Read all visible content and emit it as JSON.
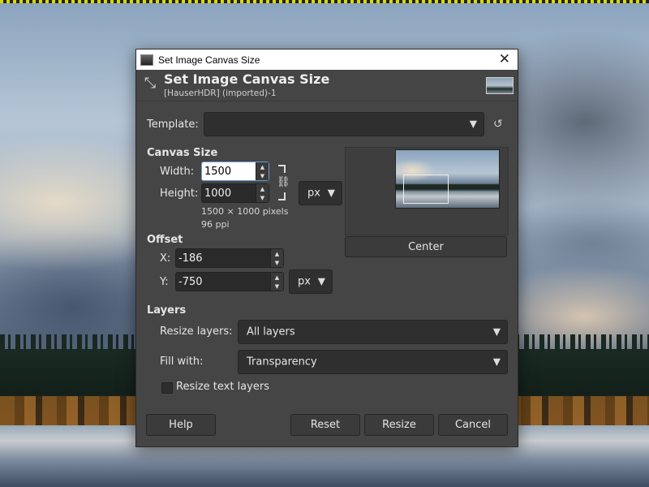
{
  "dialog": {
    "window_title": "Set Image Canvas Size",
    "header_title": "Set Image Canvas Size",
    "header_subtitle": "[HauserHDR] (imported)-1"
  },
  "template": {
    "label": "Template:",
    "value": ""
  },
  "canvas_size": {
    "section": "Canvas Size",
    "width_label": "Width:",
    "width_value": "1500",
    "height_label": "Height:",
    "height_value": "1000",
    "unit": "px",
    "pixels_info": "1500 × 1000 pixels",
    "ppi_info": "96 ppi"
  },
  "offset": {
    "section": "Offset",
    "x_label": "X:",
    "x_value": "-186",
    "y_label": "Y:",
    "y_value": "-750",
    "unit": "px",
    "center_label": "Center"
  },
  "layers": {
    "section": "Layers",
    "resize_label": "Resize layers:",
    "resize_value": "All layers",
    "fill_label": "Fill with:",
    "fill_value": "Transparency",
    "resize_text_label": "Resize text layers",
    "resize_text_checked": false
  },
  "buttons": {
    "help": "Help",
    "reset": "Reset",
    "resize": "Resize",
    "cancel": "Cancel"
  },
  "icons": {
    "close": "close-icon",
    "reset_template": "reset-icon",
    "chain": "chain-icon"
  }
}
